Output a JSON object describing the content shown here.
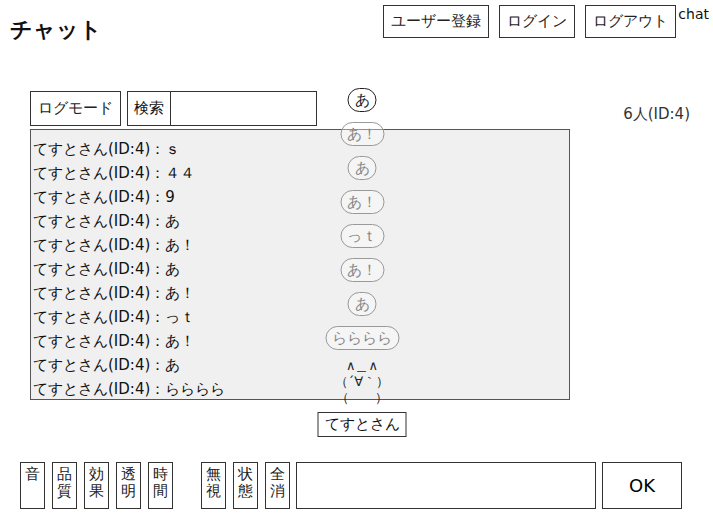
{
  "window": {
    "title": "チャット"
  },
  "header_buttons": [
    "ユーザー登録",
    "ログイン",
    "ログアウト"
  ],
  "app_tag": "chat",
  "log_mode_button": "ログモード",
  "search": {
    "label": "検索",
    "value": ""
  },
  "status": "6人(ID:4)",
  "log": [
    "てすとさん(ID:4)：ｓ",
    "てすとさん(ID:4)：４４",
    "てすとさん(ID:4)：9",
    "てすとさん(ID:4)：あ",
    "てすとさん(ID:4)：あ！",
    "てすとさん(ID:4)：あ",
    "てすとさん(ID:4)：あ！",
    "てすとさん(ID:4)：っｔ",
    "てすとさん(ID:4)：あ！",
    "てすとさん(ID:4)：あ",
    "てすとさん(ID:4)：らららら"
  ],
  "character": {
    "name": "てすとさん",
    "art": [
      "∧＿∧",
      "（´∀｀）",
      "（　　）"
    ],
    "bubbles": [
      {
        "text": "あ",
        "faded": false
      },
      {
        "text": "あ！",
        "faded": true
      },
      {
        "text": "あ",
        "faded": true
      },
      {
        "text": "あ！",
        "faded": true
      },
      {
        "text": "っｔ",
        "faded": true
      },
      {
        "text": "あ！",
        "faded": true
      },
      {
        "text": "あ",
        "faded": true
      },
      {
        "text": "らららら",
        "faded": true
      }
    ]
  },
  "toolbar": {
    "left": [
      "音",
      "品質",
      "効果",
      "透明",
      "時間"
    ],
    "right": [
      "無視",
      "状態",
      "全消"
    ]
  },
  "message_input": {
    "value": ""
  },
  "send_button": "OK"
}
